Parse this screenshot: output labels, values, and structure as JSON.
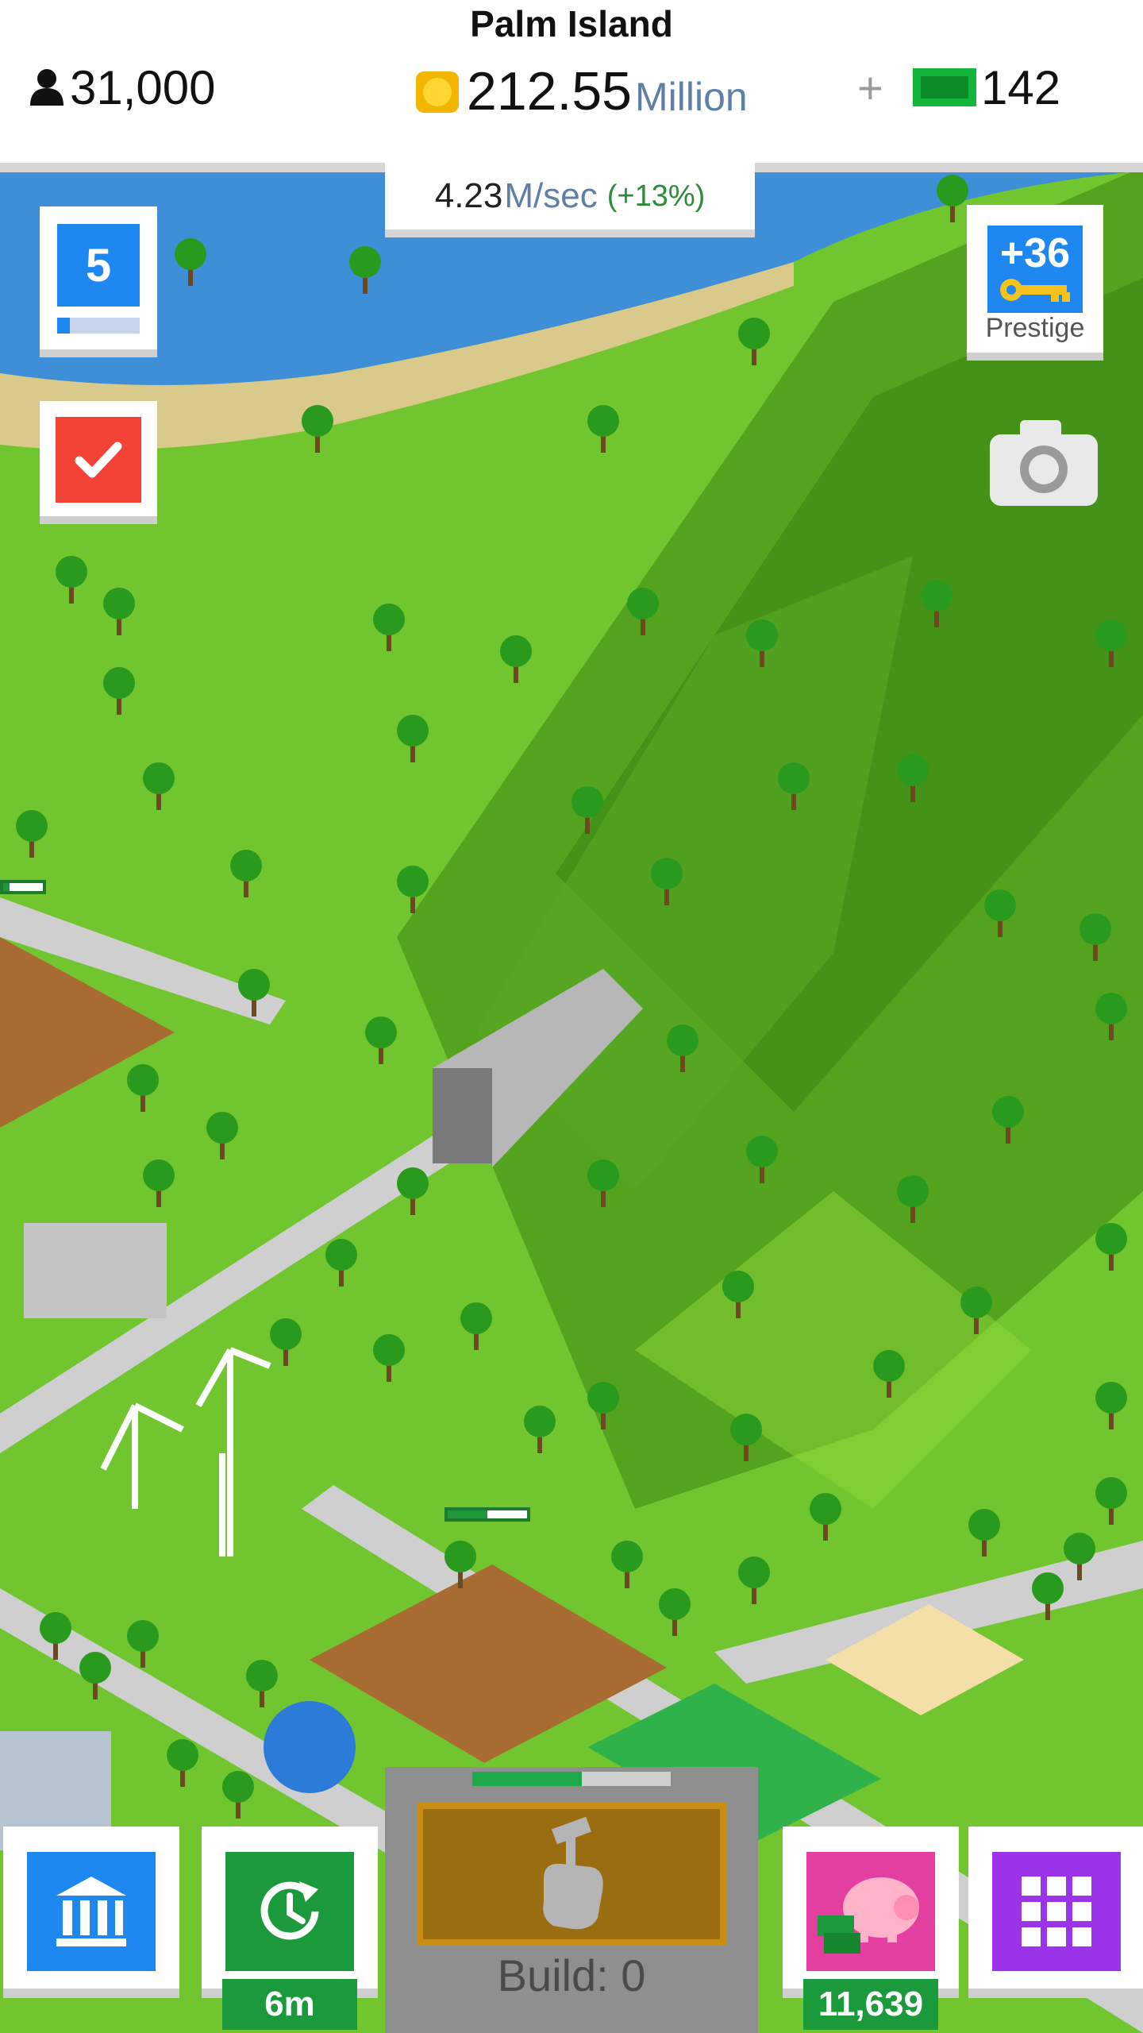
{
  "header": {
    "island_name": "Palm Island",
    "population": "31,000",
    "coins_value": "212.55",
    "coins_unit": "Million",
    "plus_symbol": "+",
    "cash_value": "142"
  },
  "income": {
    "value": "4.23",
    "unit": "M/sec",
    "bonus": "(+13%)"
  },
  "level": {
    "number": "5",
    "progress_fraction": 0.15
  },
  "prestige": {
    "amount": "+36",
    "label": "Prestige"
  },
  "bottom_bar": {
    "bank_icon": "bank-icon",
    "boost_icon": "clock-refresh-icon",
    "boost_timer": "6m",
    "build_label": "Build: 0",
    "build_progress_fraction": 0.55,
    "piggy_icon": "piggy-bank-icon",
    "piggy_value": "11,639",
    "menu_icon": "grid-menu-icon"
  },
  "map_progress_bars": [
    {
      "fraction": 0.15
    },
    {
      "fraction": 0.5
    }
  ],
  "colors": {
    "blue": "#1e88f0",
    "green": "#1a9a3a",
    "red": "#f44336",
    "purple": "#9b34e8",
    "pink": "#e33fa0"
  }
}
